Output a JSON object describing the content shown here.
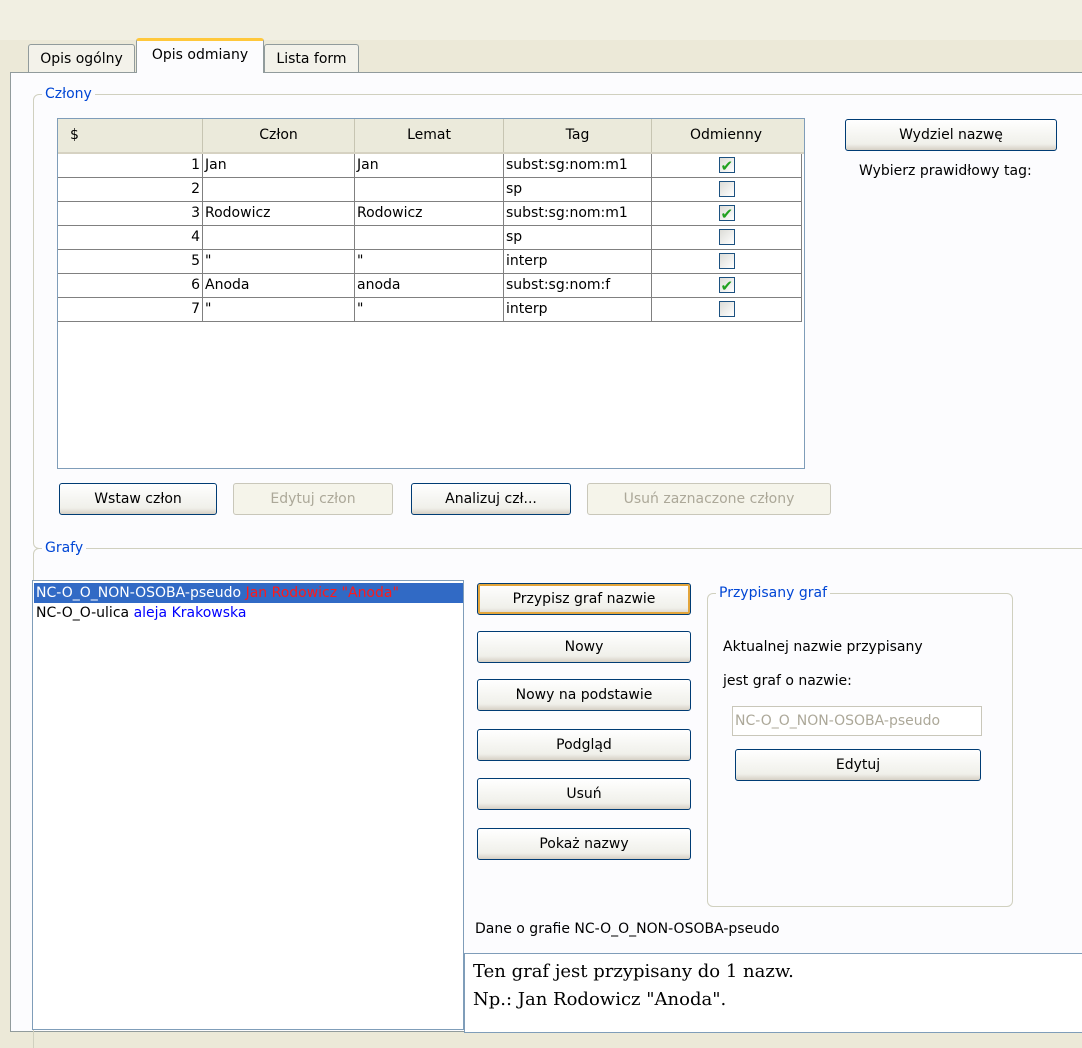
{
  "tabs": [
    {
      "label": "Opis ogólny"
    },
    {
      "label": "Opis odmiany"
    },
    {
      "label": "Lista form"
    }
  ],
  "czlony": {
    "legend": "Człony",
    "columns": [
      "$",
      "Człon",
      "Lemat",
      "Tag",
      "Odmienny"
    ],
    "rows": [
      {
        "num": "1",
        "czlon": "Jan",
        "lemat": "Jan",
        "tag": "subst:sg:nom:m1",
        "odmienny": true
      },
      {
        "num": "2",
        "czlon": "",
        "lemat": "",
        "tag": "sp",
        "odmienny": false
      },
      {
        "num": "3",
        "czlon": "Rodowicz",
        "lemat": "Rodowicz",
        "tag": "subst:sg:nom:m1",
        "odmienny": true
      },
      {
        "num": "4",
        "czlon": "",
        "lemat": "",
        "tag": "sp",
        "odmienny": false
      },
      {
        "num": "5",
        "czlon": "\"",
        "lemat": "\"",
        "tag": "interp",
        "odmienny": false
      },
      {
        "num": "6",
        "czlon": "Anoda",
        "lemat": "anoda",
        "tag": "subst:sg:nom:f",
        "odmienny": true
      },
      {
        "num": "7",
        "czlon": "\"",
        "lemat": "\"",
        "tag": "interp",
        "odmienny": false
      }
    ],
    "buttons": {
      "wstaw": "Wstaw człon",
      "edytuj": "Edytuj człon",
      "analizuj": "Analizuj czł...",
      "usun": "Usuń zaznaczone człony"
    },
    "wydziel": "Wydziel nazwę",
    "wybierz_label": "Wybierz prawidłowy tag:"
  },
  "grafy": {
    "legend": "Grafy",
    "list": [
      {
        "name": "NC-O_O_NON-OSOBA-pseudo",
        "example": "Jan Rodowicz \"Anoda\"",
        "selected": true
      },
      {
        "name": "NC-O_O-ulica",
        "example": "aleja Krakowska",
        "selected": false
      }
    ],
    "buttons": {
      "przypisz": "Przypisz graf nazwie",
      "nowy": "Nowy",
      "nowy_na_podstawie": "Nowy na podstawie",
      "podglad": "Podgląd",
      "usun": "Usuń",
      "pokaz": "Pokaż nazwy"
    },
    "przypisany": {
      "legend": "Przypisany graf",
      "line1": "Aktualnej nazwie przypisany",
      "line2": "jest graf o nazwie:",
      "value": "NC-O_O_NON-OSOBA-pseudo",
      "edytuj": "Edytuj"
    },
    "dane_label": "Dane o grafie NC-O_O_NON-OSOBA-pseudo",
    "dane_line1": "Ten graf jest przypisany do 1 nazw.",
    "dane_line2": "Np.: Jan Rodowicz \"Anoda\"."
  }
}
